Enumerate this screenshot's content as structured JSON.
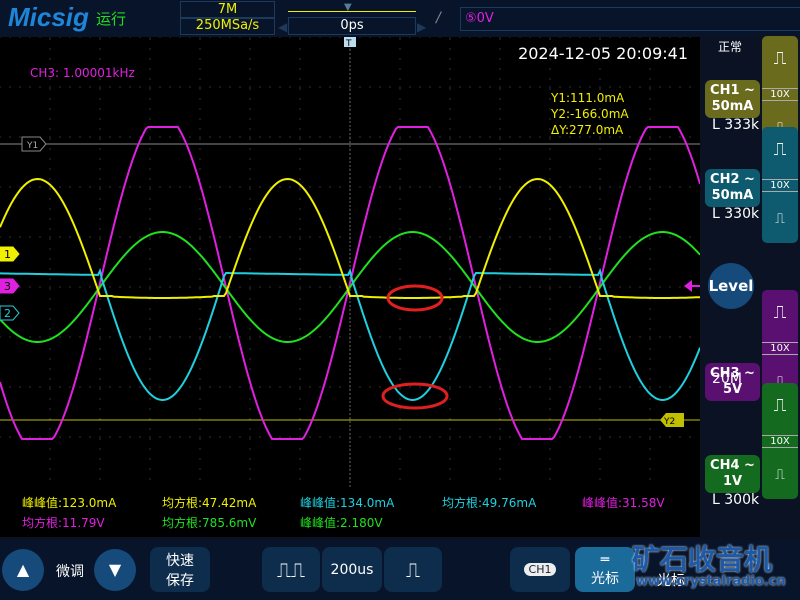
{
  "header": {
    "brand": "Micsig",
    "run_state": "运行",
    "memory_depth": "7M",
    "sample_rate": "250MSa/s",
    "time_offset": "0ps",
    "trigger_source": "⑤0V",
    "trigger_edge_icon": "rising-edge"
  },
  "display": {
    "datetime": "2024-12-05 20:09:41",
    "frequency": "CH3: 1.00001kHz",
    "cursor": {
      "y1": "Y1:111.0mA",
      "y2": "Y2:-166.0mA",
      "dy": "ΔY:277.0mA",
      "y1_label": "Y1",
      "y2_label": "Y2"
    },
    "markers": [
      "1",
      "3",
      "2"
    ],
    "trigger_marker": "T"
  },
  "measurements": [
    {
      "text": "峰峰值:123.0mA",
      "color": "#f0f000"
    },
    {
      "text": "均方根:47.42mA",
      "color": "#f0f000"
    },
    {
      "text": "峰峰值:134.0mA",
      "color": "#20d0e0"
    },
    {
      "text": "均方根:49.76mA",
      "color": "#20d0e0"
    },
    {
      "text": "峰峰值:31.58V",
      "color": "#e020e0"
    },
    {
      "text": "均方根:11.79V",
      "color": "#e020e0"
    },
    {
      "text": "均方根:785.6mV",
      "color": "#20e020"
    },
    {
      "text": "峰峰值:2.180V",
      "color": "#20e020"
    }
  ],
  "sidebar": {
    "mode": "正常",
    "level": "Level",
    "channels": [
      {
        "name": "CH1 ~",
        "scale": "50mA",
        "info": "L 333k",
        "color": "#6b6b1e",
        "probe": "10X"
      },
      {
        "name": "CH2 ~",
        "scale": "50mA",
        "info": "L 330k",
        "color": "#0e5a6e",
        "probe": "10X"
      },
      {
        "name": "CH3 ~",
        "scale": "5V",
        "info": "20M",
        "color": "#5a1070",
        "probe": "10X"
      },
      {
        "name": "CH4 ~",
        "scale": "1V",
        "info": "L 300k",
        "color": "#146a1e",
        "probe": "10X"
      }
    ]
  },
  "footer": {
    "fine": "微调",
    "quick_save": "快速\n保存",
    "timebase": "200us",
    "ch_select": "CH1",
    "cursor": "光标",
    "cursor2": "光标"
  },
  "watermark": {
    "title": "矿石收音机",
    "url": "www.crystalradio.cn"
  },
  "colors": {
    "ch1": "#f0f000",
    "ch2": "#20d0e0",
    "ch3": "#e020e0",
    "ch4": "#20e020"
  }
}
